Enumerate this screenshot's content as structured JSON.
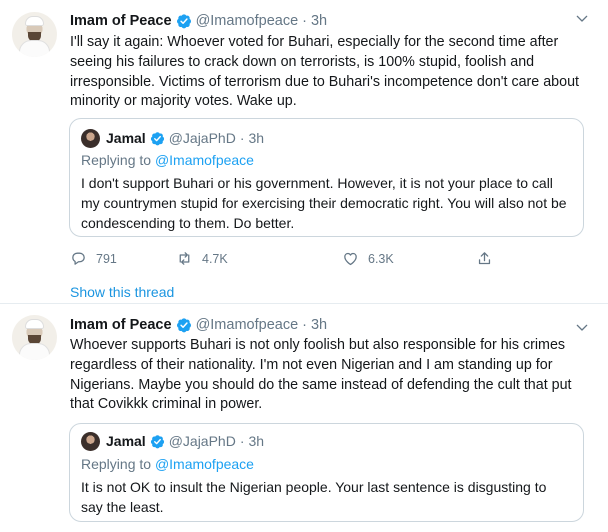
{
  "colors": {
    "accent": "#1da1f2",
    "text": "#14171a",
    "muted": "#657786",
    "border": "#ccd6dd"
  },
  "tweets": [
    {
      "author": {
        "name": "Imam of Peace",
        "handle": "@Imamofpeace",
        "time": "3h",
        "verified": true
      },
      "separator": "·",
      "text": "I'll say it again: Whoever voted for Buhari, especially for the second time after seeing his failures to crack down on terrorists, is 100% stupid, foolish and irresponsible. Victims of terrorism due to Buhari's incompetence don't care about minority or majority votes. Wake up.",
      "quote": {
        "author": {
          "name": "Jamal",
          "handle": "@JajaPhD",
          "time": "3h",
          "verified": true
        },
        "replying_to_prefix": "Replying to ",
        "replying_to_handle": "@Imamofpeace",
        "text": "I don't support Buhari or his government. However, it is not your place to call my countrymen stupid for exercising their democratic right. You will also not be condescending to them. Do better."
      },
      "actions": {
        "replies": "791",
        "retweets": "4.7K",
        "likes": "6.3K"
      },
      "show_thread": "Show this thread"
    },
    {
      "author": {
        "name": "Imam of Peace",
        "handle": "@Imamofpeace",
        "time": "3h",
        "verified": true
      },
      "separator": "·",
      "text": "Whoever supports Buhari is not only foolish but also responsible for his crimes regardless of their nationality. I'm not even Nigerian and I am standing up for Nigerians. Maybe you should do the same instead of defending the cult that put that Covikkk criminal in power.",
      "quote": {
        "author": {
          "name": "Jamal",
          "handle": "@JajaPhD",
          "time": "3h",
          "verified": true
        },
        "replying_to_prefix": "Replying to ",
        "replying_to_handle": "@Imamofpeace",
        "text": "It is not OK to insult the Nigerian people. Your last sentence is disgusting to say the least."
      }
    }
  ],
  "icons": {
    "verified": "verified-badge-icon",
    "caret": "chevron-down-icon",
    "reply": "reply-icon",
    "retweet": "retweet-icon",
    "like": "heart-icon",
    "share": "share-icon"
  }
}
